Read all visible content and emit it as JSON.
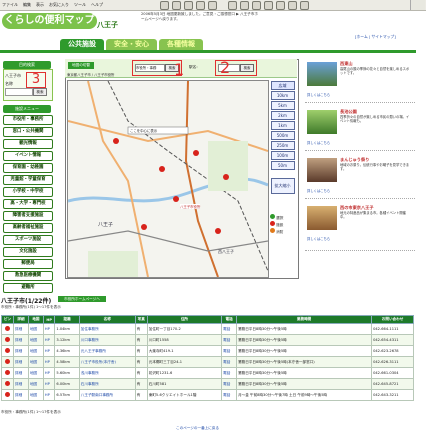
{
  "browser": {
    "menu": [
      "ファイル",
      "編集",
      "表示",
      "お気に入り",
      "ツール",
      "ヘルプ"
    ]
  },
  "header": {
    "logo_text": "くらしの便利マップ",
    "city": "八王子",
    "note": "2006年5月3日 地図更新致しました。ご意見・ご感想窓口 ▶ 八王子市ホームページへ戻ります。",
    "right_link": "[ホーム | サイトマップ]",
    "tabs": [
      "公共施設",
      "安全・安心",
      "各種情報"
    ]
  },
  "left": {
    "heading": "目的検索",
    "search_label1": "八王子市",
    "search_label2": "名称",
    "search_button": "検索",
    "annotation": "3",
    "nav_heading": "施設メニュー",
    "items": [
      "市役所・事務所",
      "窓口・公共機関",
      "観光情報",
      "イベント情報",
      "保育園・幼稚園",
      "児童館・学童保育",
      "小学校・中学校",
      "高・大学・専門校",
      "障害者支援施設",
      "高齢者福祉施設",
      "スポーツ施設",
      "文化施設",
      "郵便局",
      "救急医療機関",
      "避難所"
    ]
  },
  "map": {
    "top_button": "地図の切替",
    "select1": "市役所・事務",
    "search_btn1": "検索",
    "label_station": "駅名：",
    "search_btn2": "検索",
    "annotation1": "1",
    "annotation2": "2",
    "breadcrumb": "東京都八王子市 / 八王子市役所",
    "center_label": "ここを中心に表示",
    "place_label": "八王子市役所",
    "area_label1": "八王子",
    "area_label2": "西八王子",
    "scale_items": [
      "広域",
      "10km",
      "5km",
      "2km",
      "1km",
      "500m",
      "250m",
      "100m",
      "50m"
    ],
    "nav_button": "拡大縮小",
    "legend": [
      "選択",
      "施設",
      "消防"
    ]
  },
  "right": {
    "ads": [
      {
        "title": "西東山",
        "desc": "高尾山の麓の季節の花々と自然を楽しめるスポットです。",
        "more": "詳しくはこちら"
      },
      {
        "title": "長池公園",
        "desc": "四季折々の自然が楽しめる市民の憩いの場。イベント情報も。",
        "more": "詳しくはこちら"
      },
      {
        "title": "まんじゅう祭り",
        "desc": "地域のお祭り。伝統行事やお囃子を見学できます。",
        "more": "詳しくはこちら"
      },
      {
        "title": "西の市東京八王子",
        "desc": "地元の特産品が集まる市。各種イベント開催中。",
        "more": "詳しくはこちら"
      }
    ]
  },
  "results": {
    "title": "八王子市(1/22件)",
    "button": "市役所ホームページへ",
    "count": "市役所・事務所(1件)  1〜17件を表示",
    "columns": [
      "ピン",
      "詳細",
      "地図",
      "HP",
      "距離",
      "名称",
      "写真",
      "住所",
      "電話",
      "業務時間",
      "お問い合わせ"
    ],
    "rows": [
      [
        "詳細",
        "地図",
        "HP",
        "1.04km",
        "加住事務所",
        "有",
        "加住町一丁目170-2",
        "電話",
        "業務日平日8時30分〜午後5時",
        "042-664-1111"
      ],
      [
        "詳細",
        "地図",
        "HP",
        "3.12km",
        "川口事務所",
        "有",
        "川口町1558",
        "電話",
        "業務日平日8時30分〜午後5時",
        "042-654-4311"
      ],
      [
        "詳細",
        "地図",
        "HP",
        "4.36km",
        "元八王子事務所",
        "有",
        "大楽寺町419-1",
        "電話",
        "業務日平日8時30分〜午後5時",
        "042-623-2678"
      ],
      [
        "詳細",
        "地図",
        "HP",
        "4.58km",
        "八王子市役所(本庁舎)",
        "有",
        "元本郷町三丁目24-1",
        "電話",
        "業務日平日8時30分〜午後5時(本庁舎一部窓口)",
        "042-626-3111"
      ],
      [
        "詳細",
        "地図",
        "HP",
        "5.60km",
        "浅川事務所",
        "有",
        "初沢町1231-6",
        "電話",
        "業務日平日8時30分〜午後5時",
        "042-661-0304"
      ],
      [
        "詳細",
        "地図",
        "HP",
        "6.00km",
        "石川事務所",
        "有",
        "石川町581",
        "電話",
        "業務日平日8時30分〜午後5時",
        "042-645-8721"
      ],
      [
        "詳細",
        "地図",
        "HP",
        "6.57km",
        "八王子駅南口事務所",
        "有",
        "東町5-6クリエイトホール1階",
        "電話",
        "月〜金 午前8時30分〜午後7時 土日 午前9時〜午後5時",
        "042-643-3211"
      ]
    ],
    "count_bottom": "市役所・事務所(1件)  1〜17件を表示",
    "footer_link": "このページの一番上に戻る"
  },
  "colors": {
    "green": "#2f9a2c",
    "light_green": "#88c34f",
    "annotation_red": "#e03030"
  }
}
